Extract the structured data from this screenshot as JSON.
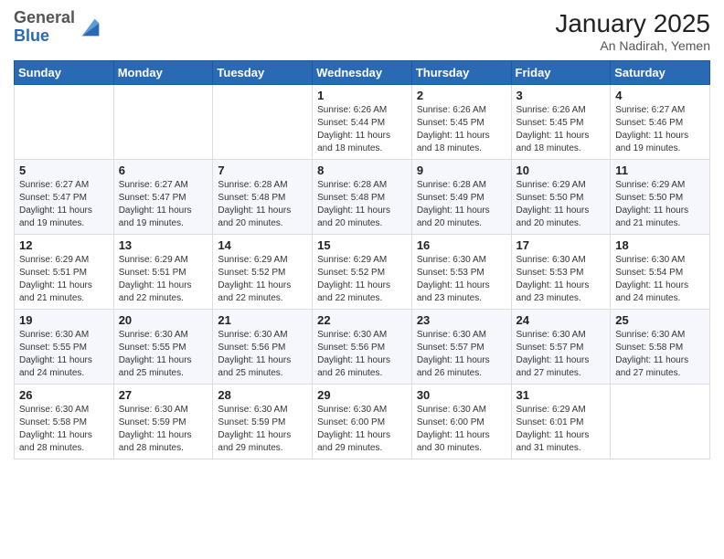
{
  "logo": {
    "general": "General",
    "blue": "Blue"
  },
  "header": {
    "month": "January 2025",
    "location": "An Nadirah, Yemen"
  },
  "weekdays": [
    "Sunday",
    "Monday",
    "Tuesday",
    "Wednesday",
    "Thursday",
    "Friday",
    "Saturday"
  ],
  "weeks": [
    [
      {
        "day": "",
        "sunrise": "",
        "sunset": "",
        "daylight": ""
      },
      {
        "day": "",
        "sunrise": "",
        "sunset": "",
        "daylight": ""
      },
      {
        "day": "",
        "sunrise": "",
        "sunset": "",
        "daylight": ""
      },
      {
        "day": "1",
        "sunrise": "Sunrise: 6:26 AM",
        "sunset": "Sunset: 5:44 PM",
        "daylight": "Daylight: 11 hours and 18 minutes."
      },
      {
        "day": "2",
        "sunrise": "Sunrise: 6:26 AM",
        "sunset": "Sunset: 5:45 PM",
        "daylight": "Daylight: 11 hours and 18 minutes."
      },
      {
        "day": "3",
        "sunrise": "Sunrise: 6:26 AM",
        "sunset": "Sunset: 5:45 PM",
        "daylight": "Daylight: 11 hours and 18 minutes."
      },
      {
        "day": "4",
        "sunrise": "Sunrise: 6:27 AM",
        "sunset": "Sunset: 5:46 PM",
        "daylight": "Daylight: 11 hours and 19 minutes."
      }
    ],
    [
      {
        "day": "5",
        "sunrise": "Sunrise: 6:27 AM",
        "sunset": "Sunset: 5:47 PM",
        "daylight": "Daylight: 11 hours and 19 minutes."
      },
      {
        "day": "6",
        "sunrise": "Sunrise: 6:27 AM",
        "sunset": "Sunset: 5:47 PM",
        "daylight": "Daylight: 11 hours and 19 minutes."
      },
      {
        "day": "7",
        "sunrise": "Sunrise: 6:28 AM",
        "sunset": "Sunset: 5:48 PM",
        "daylight": "Daylight: 11 hours and 20 minutes."
      },
      {
        "day": "8",
        "sunrise": "Sunrise: 6:28 AM",
        "sunset": "Sunset: 5:48 PM",
        "daylight": "Daylight: 11 hours and 20 minutes."
      },
      {
        "day": "9",
        "sunrise": "Sunrise: 6:28 AM",
        "sunset": "Sunset: 5:49 PM",
        "daylight": "Daylight: 11 hours and 20 minutes."
      },
      {
        "day": "10",
        "sunrise": "Sunrise: 6:29 AM",
        "sunset": "Sunset: 5:50 PM",
        "daylight": "Daylight: 11 hours and 20 minutes."
      },
      {
        "day": "11",
        "sunrise": "Sunrise: 6:29 AM",
        "sunset": "Sunset: 5:50 PM",
        "daylight": "Daylight: 11 hours and 21 minutes."
      }
    ],
    [
      {
        "day": "12",
        "sunrise": "Sunrise: 6:29 AM",
        "sunset": "Sunset: 5:51 PM",
        "daylight": "Daylight: 11 hours and 21 minutes."
      },
      {
        "day": "13",
        "sunrise": "Sunrise: 6:29 AM",
        "sunset": "Sunset: 5:51 PM",
        "daylight": "Daylight: 11 hours and 22 minutes."
      },
      {
        "day": "14",
        "sunrise": "Sunrise: 6:29 AM",
        "sunset": "Sunset: 5:52 PM",
        "daylight": "Daylight: 11 hours and 22 minutes."
      },
      {
        "day": "15",
        "sunrise": "Sunrise: 6:29 AM",
        "sunset": "Sunset: 5:52 PM",
        "daylight": "Daylight: 11 hours and 22 minutes."
      },
      {
        "day": "16",
        "sunrise": "Sunrise: 6:30 AM",
        "sunset": "Sunset: 5:53 PM",
        "daylight": "Daylight: 11 hours and 23 minutes."
      },
      {
        "day": "17",
        "sunrise": "Sunrise: 6:30 AM",
        "sunset": "Sunset: 5:53 PM",
        "daylight": "Daylight: 11 hours and 23 minutes."
      },
      {
        "day": "18",
        "sunrise": "Sunrise: 6:30 AM",
        "sunset": "Sunset: 5:54 PM",
        "daylight": "Daylight: 11 hours and 24 minutes."
      }
    ],
    [
      {
        "day": "19",
        "sunrise": "Sunrise: 6:30 AM",
        "sunset": "Sunset: 5:55 PM",
        "daylight": "Daylight: 11 hours and 24 minutes."
      },
      {
        "day": "20",
        "sunrise": "Sunrise: 6:30 AM",
        "sunset": "Sunset: 5:55 PM",
        "daylight": "Daylight: 11 hours and 25 minutes."
      },
      {
        "day": "21",
        "sunrise": "Sunrise: 6:30 AM",
        "sunset": "Sunset: 5:56 PM",
        "daylight": "Daylight: 11 hours and 25 minutes."
      },
      {
        "day": "22",
        "sunrise": "Sunrise: 6:30 AM",
        "sunset": "Sunset: 5:56 PM",
        "daylight": "Daylight: 11 hours and 26 minutes."
      },
      {
        "day": "23",
        "sunrise": "Sunrise: 6:30 AM",
        "sunset": "Sunset: 5:57 PM",
        "daylight": "Daylight: 11 hours and 26 minutes."
      },
      {
        "day": "24",
        "sunrise": "Sunrise: 6:30 AM",
        "sunset": "Sunset: 5:57 PM",
        "daylight": "Daylight: 11 hours and 27 minutes."
      },
      {
        "day": "25",
        "sunrise": "Sunrise: 6:30 AM",
        "sunset": "Sunset: 5:58 PM",
        "daylight": "Daylight: 11 hours and 27 minutes."
      }
    ],
    [
      {
        "day": "26",
        "sunrise": "Sunrise: 6:30 AM",
        "sunset": "Sunset: 5:58 PM",
        "daylight": "Daylight: 11 hours and 28 minutes."
      },
      {
        "day": "27",
        "sunrise": "Sunrise: 6:30 AM",
        "sunset": "Sunset: 5:59 PM",
        "daylight": "Daylight: 11 hours and 28 minutes."
      },
      {
        "day": "28",
        "sunrise": "Sunrise: 6:30 AM",
        "sunset": "Sunset: 5:59 PM",
        "daylight": "Daylight: 11 hours and 29 minutes."
      },
      {
        "day": "29",
        "sunrise": "Sunrise: 6:30 AM",
        "sunset": "Sunset: 6:00 PM",
        "daylight": "Daylight: 11 hours and 29 minutes."
      },
      {
        "day": "30",
        "sunrise": "Sunrise: 6:30 AM",
        "sunset": "Sunset: 6:00 PM",
        "daylight": "Daylight: 11 hours and 30 minutes."
      },
      {
        "day": "31",
        "sunrise": "Sunrise: 6:29 AM",
        "sunset": "Sunset: 6:01 PM",
        "daylight": "Daylight: 11 hours and 31 minutes."
      },
      {
        "day": "",
        "sunrise": "",
        "sunset": "",
        "daylight": ""
      }
    ]
  ]
}
